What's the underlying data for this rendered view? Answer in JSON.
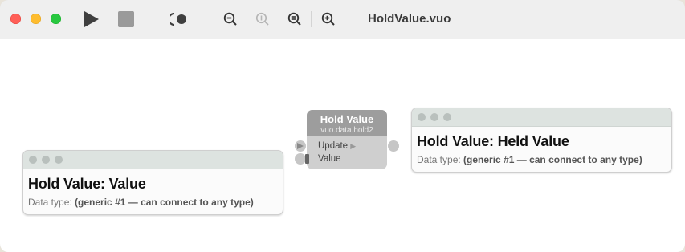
{
  "window": {
    "title": "HoldValue.vuo"
  },
  "toolbar": {
    "run_icon": "play-icon",
    "stop_icon": "stop-icon",
    "show_events_icon": "show-events-icon",
    "zoom_out_icon": "zoom-out-icon",
    "actual_size_icon": "zoom-actual-size-icon",
    "zoom_to_fit_icon": "zoom-to-fit-icon",
    "zoom_in_icon": "zoom-in-icon"
  },
  "input_port_card": {
    "title": "Hold Value: Value",
    "data_type_label": "Data type:",
    "data_type_value": "(generic #1 — can connect to any type)"
  },
  "node": {
    "title": "Hold Value",
    "class_name": "vuo.data.hold2",
    "ports": [
      "Update",
      "Value"
    ]
  },
  "output_port_card": {
    "title": "Hold Value: Held Value",
    "data_type_label": "Data type:",
    "data_type_value": "(generic #1 — can connect to any type)"
  },
  "colors": {
    "node_header": "#9d9d9d",
    "node_body": "#cfcfcf",
    "card_header": "#dde3e0"
  }
}
